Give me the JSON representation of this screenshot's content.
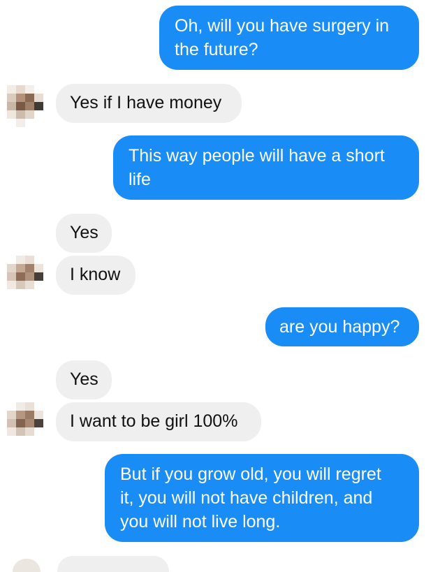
{
  "messages": [
    {
      "side": "outgoing",
      "text": "Oh, will you have surgery in\nthe future?"
    },
    {
      "side": "incoming",
      "text": "Yes if I have money"
    },
    {
      "side": "outgoing",
      "text": "This way people will have a short\nlife"
    },
    {
      "side": "incoming",
      "text": "Yes"
    },
    {
      "side": "incoming",
      "text": "I know"
    },
    {
      "side": "outgoing",
      "text": "are you happy?"
    },
    {
      "side": "incoming",
      "text": "Yes"
    },
    {
      "side": "incoming",
      "text": "I want to be girl 100%"
    },
    {
      "side": "outgoing",
      "text": "But if you grow old, you will regret\nit, you will not have children, and\nyou will not live long."
    }
  ],
  "colors": {
    "outgoing_bubble": "#1a8cf5",
    "incoming_bubble": "#efeff0",
    "outgoing_text": "#ffffff",
    "incoming_text": "#111111"
  },
  "icons": {
    "avatar": "pixelated-avatar-icon"
  }
}
